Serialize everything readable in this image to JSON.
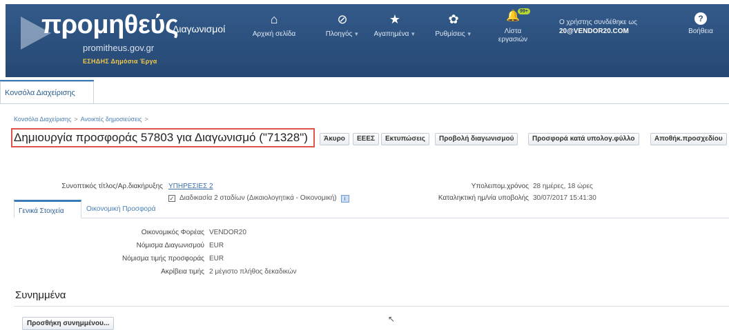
{
  "header": {
    "logo_main": "προμηθεύς",
    "logo_sub": "Διαγωνισμοί",
    "logo_url": "promitheus.gov.gr",
    "logo_org": "ΕΣΗΔΗΣ Δημόσια Έργα",
    "nav": [
      {
        "label": "Αρχική σελίδα",
        "icon": "home-icon",
        "glyph": "⌂"
      },
      {
        "label": "Πλοηγός",
        "icon": "compass-icon",
        "glyph": "⊘"
      },
      {
        "label": "Αγαπημένα",
        "icon": "star-icon",
        "glyph": "★"
      },
      {
        "label": "Ρυθμίσεις",
        "icon": "gear-icon",
        "glyph": "✿"
      },
      {
        "label": "Λίστα εργασιών",
        "icon": "bell-icon",
        "glyph": "🔔"
      }
    ],
    "notification_badge": "99+",
    "user_line1": "Ο χρήστης συνδέθηκε ως",
    "user_line2": "20@VENDOR20.COM",
    "help_label": "Βοήθεια"
  },
  "tabs": {
    "console": "Κονσόλα Διαχείρισης"
  },
  "breadcrumb": [
    "Κονσόλα Διαχείρισης",
    "Ανοικτές δημοσιεύσεις"
  ],
  "page_title": "Δημιουργία προσφοράς 57803 για Διαγωνισμό (\"71328\")",
  "buttons": {
    "cancel": "Άκυρο",
    "eeee": "ΕΕΕΣ",
    "prints": "Εκτυπώσεις",
    "view_tender": "Προβολή διαγωνισμού",
    "spreadsheet": "Προσφορά κατά υπολογ.φύλλο",
    "save_draft": "Αποθήκ.προσχεδίου"
  },
  "summary": {
    "title_label": "Συνοπτικός τίτλος/Αρ.διακήρυξης",
    "title_value": "ΥΠΗΡΕΣΙΕΣ 2",
    "two_stage": "Διαδικασία 2 σταδίων (Δικαιολογητικά - Οικονομική)",
    "remaining_label": "Υπολειπομ.χρόνος",
    "remaining_value": "28 ημέρες, 18 ώρες",
    "deadline_label": "Καταληκτική ημ/νία υποβολής",
    "deadline_value": "30/07/2017 15:41:30"
  },
  "subtabs": {
    "general": "Γενικά Στοιχεία",
    "financial": "Οικονομική Προσφορά"
  },
  "general": {
    "rows": [
      {
        "label": "Οικονομικός Φορέας",
        "value": "VENDOR20"
      },
      {
        "label": "Νόμισμα Διαγωνισμού",
        "value": "EUR"
      },
      {
        "label": "Νόμισμα τιμής προσφοράς",
        "value": "EUR"
      },
      {
        "label": "Ακρίβεια τιμής",
        "value": "2 μέγιστο πλήθος δεκαδικών"
      }
    ]
  },
  "attachments": {
    "title": "Συνημμένα",
    "add_button": "Προσθήκη συνημμένου..."
  }
}
